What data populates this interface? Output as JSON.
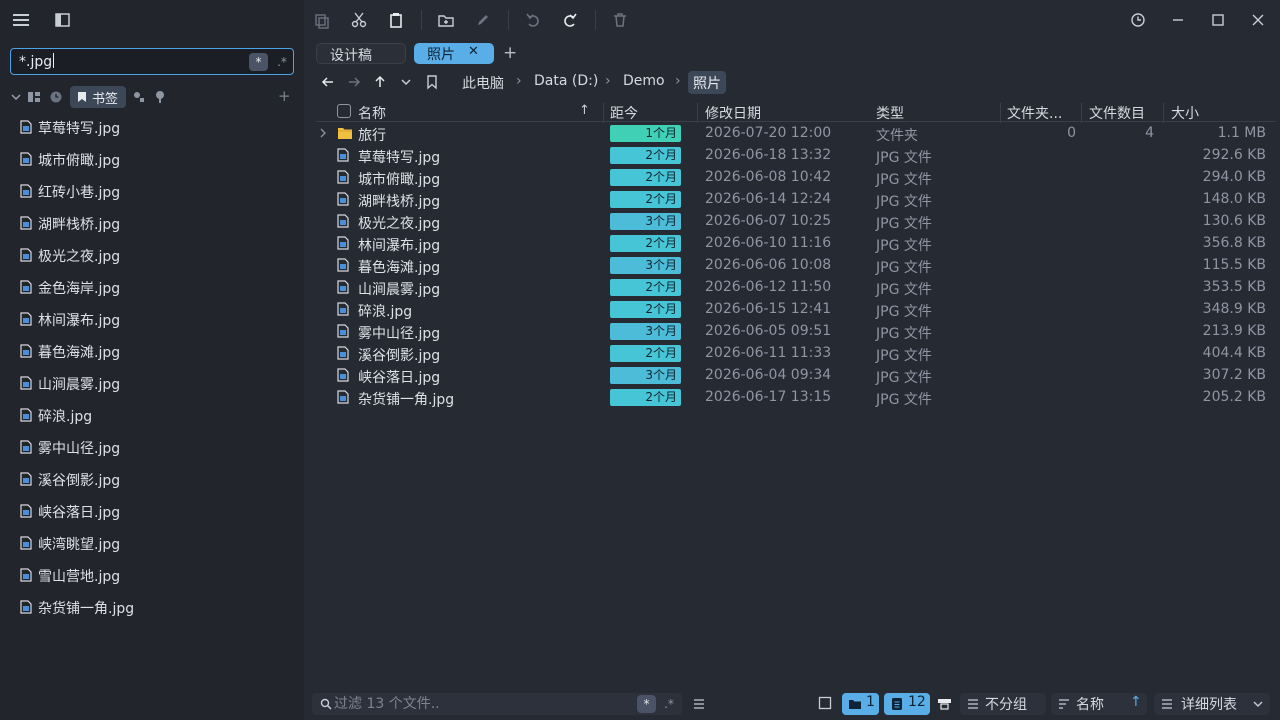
{
  "search": {
    "value": "*.jpg",
    "wildcard_label": "*",
    "regex_label": ".*"
  },
  "tagbar": {
    "bookmark_label": "书签",
    "add_label": "+"
  },
  "sidebar": {
    "items": [
      "草莓特写.jpg",
      "城市俯瞰.jpg",
      "红砖小巷.jpg",
      "湖畔栈桥.jpg",
      "极光之夜.jpg",
      "金色海岸.jpg",
      "林间瀑布.jpg",
      "暮色海滩.jpg",
      "山涧晨雾.jpg",
      "碎浪.jpg",
      "雾中山径.jpg",
      "溪谷倒影.jpg",
      "峡谷落日.jpg",
      "峡湾眺望.jpg",
      "雪山营地.jpg",
      "杂货铺一角.jpg"
    ]
  },
  "tabs": [
    {
      "label": "设计稿"
    },
    {
      "label": "照片",
      "close": "✕"
    }
  ],
  "tab_add": "+",
  "breadcrumb": [
    "此电脑",
    "Data (D:)",
    "Demo",
    "照片"
  ],
  "breadcrumb_sep": "›",
  "columns": {
    "name": "名称",
    "age": "距今",
    "modified": "修改日期",
    "type": "类型",
    "folder_count": "文件夹...",
    "file_count": "文件数目",
    "size": "大小"
  },
  "sort_indicator": "↑",
  "rows": [
    {
      "kind": "folder",
      "name": "旅行",
      "age": "1个月",
      "age_color": "#3fd0b6",
      "modified": "2026-07-20 12:00",
      "type": "文件夹",
      "folders": "0",
      "files": "4",
      "size": "1.1 MB"
    },
    {
      "kind": "file",
      "name": "草莓特写.jpg",
      "age": "2个月",
      "age_color": "#45c5d5",
      "modified": "2026-06-18 13:32",
      "type": "JPG 文件",
      "folders": "",
      "files": "",
      "size": "292.6 KB"
    },
    {
      "kind": "file",
      "name": "城市俯瞰.jpg",
      "age": "2个月",
      "age_color": "#45c5d5",
      "modified": "2026-06-08 10:42",
      "type": "JPG 文件",
      "folders": "",
      "files": "",
      "size": "294.0 KB"
    },
    {
      "kind": "file",
      "name": "湖畔栈桥.jpg",
      "age": "2个月",
      "age_color": "#45c5d5",
      "modified": "2026-06-14 12:24",
      "type": "JPG 文件",
      "folders": "",
      "files": "",
      "size": "148.0 KB"
    },
    {
      "kind": "file",
      "name": "极光之夜.jpg",
      "age": "3个月",
      "age_color": "#4cbcd8",
      "modified": "2026-06-07 10:25",
      "type": "JPG 文件",
      "folders": "",
      "files": "",
      "size": "130.6 KB"
    },
    {
      "kind": "file",
      "name": "林间瀑布.jpg",
      "age": "2个月",
      "age_color": "#45c5d5",
      "modified": "2026-06-10 11:16",
      "type": "JPG 文件",
      "folders": "",
      "files": "",
      "size": "356.8 KB"
    },
    {
      "kind": "file",
      "name": "暮色海滩.jpg",
      "age": "3个月",
      "age_color": "#4cbcd8",
      "modified": "2026-06-06 10:08",
      "type": "JPG 文件",
      "folders": "",
      "files": "",
      "size": "115.5 KB"
    },
    {
      "kind": "file",
      "name": "山涧晨雾.jpg",
      "age": "2个月",
      "age_color": "#45c5d5",
      "modified": "2026-06-12 11:50",
      "type": "JPG 文件",
      "folders": "",
      "files": "",
      "size": "353.5 KB"
    },
    {
      "kind": "file",
      "name": "碎浪.jpg",
      "age": "2个月",
      "age_color": "#45c5d5",
      "modified": "2026-06-15 12:41",
      "type": "JPG 文件",
      "folders": "",
      "files": "",
      "size": "348.9 KB"
    },
    {
      "kind": "file",
      "name": "雾中山径.jpg",
      "age": "3个月",
      "age_color": "#4cbcd8",
      "modified": "2026-06-05 09:51",
      "type": "JPG 文件",
      "folders": "",
      "files": "",
      "size": "213.9 KB"
    },
    {
      "kind": "file",
      "name": "溪谷倒影.jpg",
      "age": "2个月",
      "age_color": "#45c5d5",
      "modified": "2026-06-11 11:33",
      "type": "JPG 文件",
      "folders": "",
      "files": "",
      "size": "404.4 KB"
    },
    {
      "kind": "file",
      "name": "峡谷落日.jpg",
      "age": "3个月",
      "age_color": "#4cbcd8",
      "modified": "2026-06-04 09:34",
      "type": "JPG 文件",
      "folders": "",
      "files": "",
      "size": "307.2 KB"
    },
    {
      "kind": "file",
      "name": "杂货铺一角.jpg",
      "age": "2个月",
      "age_color": "#45c5d5",
      "modified": "2026-06-17 13:15",
      "type": "JPG 文件",
      "folders": "",
      "files": "",
      "size": "205.2 KB"
    }
  ],
  "statusbar": {
    "filter_placeholder": "过滤 13 个文件..",
    "wildcard_label": "*",
    "regex_label": ".*",
    "folder_count": "1",
    "file_count": "12",
    "group_label": "不分组",
    "sort_label": "名称",
    "sort_dir": "↑",
    "view_label": "详细列表"
  },
  "colors": {
    "accent": "#5aaee8",
    "background": "#262a33",
    "sidebar": "#22252c",
    "folder": "#f0c040",
    "file_icon": "#4a8fd8"
  }
}
